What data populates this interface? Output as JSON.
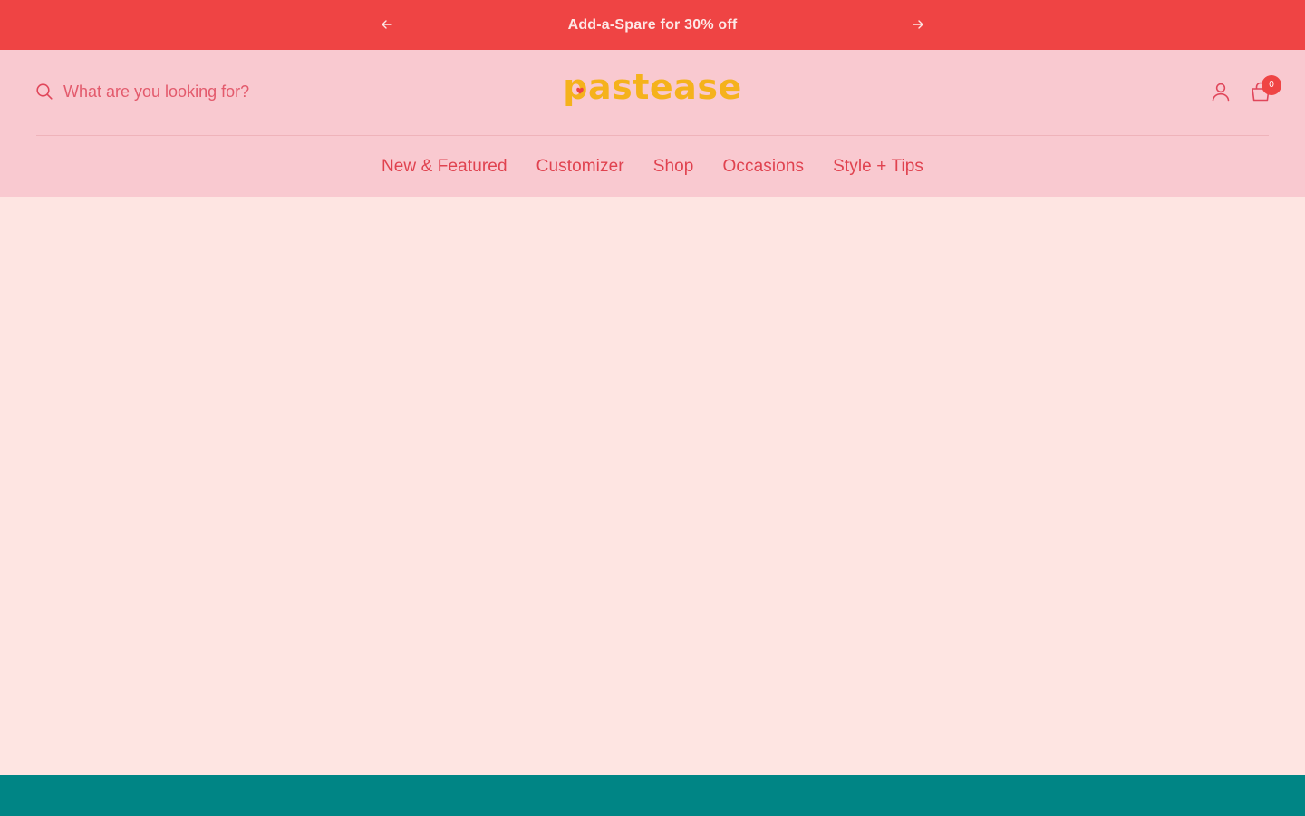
{
  "announcement": {
    "text": "Add-a-Spare for 30% off",
    "prev_icon": "arrow-left-icon",
    "next_icon": "arrow-right-icon"
  },
  "header": {
    "search": {
      "placeholder": "What are you looking for?",
      "value": ""
    },
    "logo_text": "pastease",
    "account_icon": "user-icon",
    "cart_icon": "bag-icon",
    "cart_count": "0"
  },
  "nav": {
    "items": [
      {
        "label": "New & Featured"
      },
      {
        "label": "Customizer"
      },
      {
        "label": "Shop"
      },
      {
        "label": "Occasions"
      },
      {
        "label": "Style + Tips"
      }
    ]
  },
  "colors": {
    "announcement_bg": "#ef4444",
    "header_bg": "#f9c9d0",
    "page_bg": "#fee5e2",
    "nav_text": "#e0424f",
    "logo": "#f5b21c",
    "footer_bg": "#008585"
  }
}
